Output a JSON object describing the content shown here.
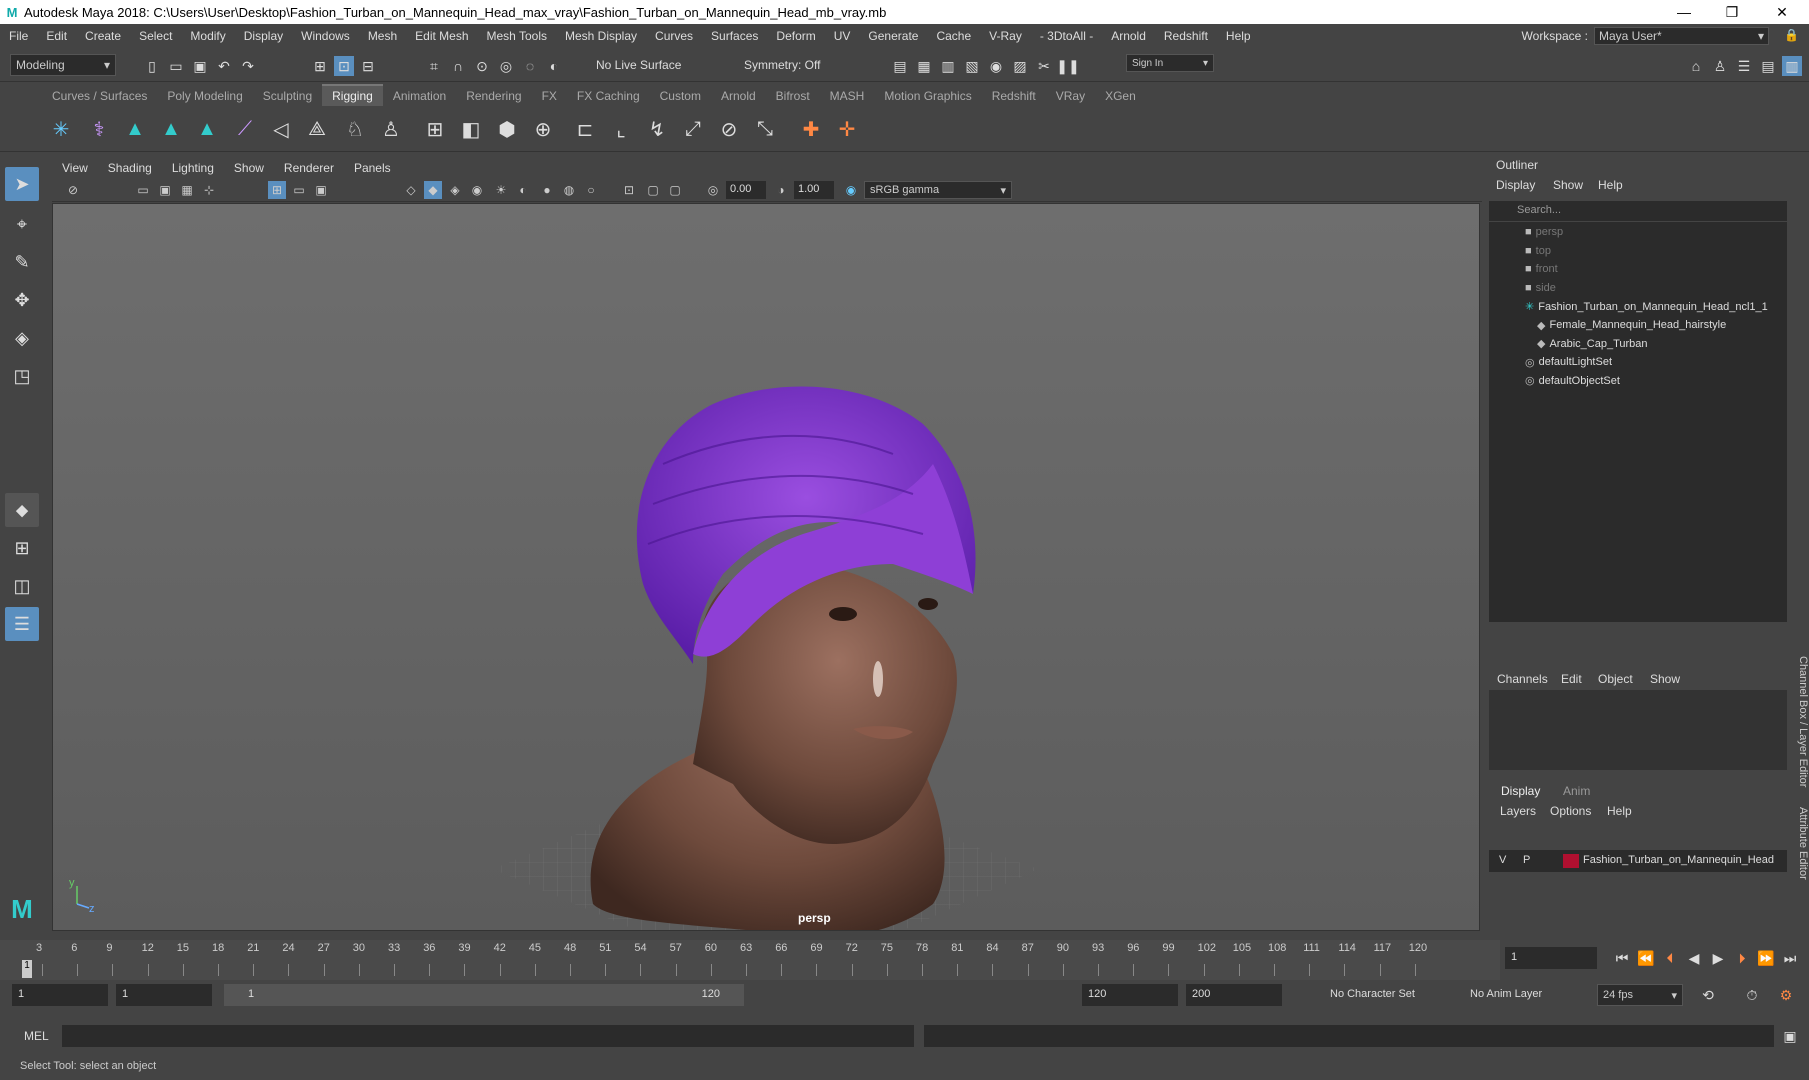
{
  "window": {
    "title": "Autodesk Maya 2018: C:\\Users\\User\\Desktop\\Fashion_Turban_on_Mannequin_Head_max_vray\\Fashion_Turban_on_Mannequin_Head_mb_vray.mb",
    "logo": "M",
    "min": "—",
    "max": "❐",
    "close": "✕"
  },
  "menubar": [
    "File",
    "Edit",
    "Create",
    "Select",
    "Modify",
    "Display",
    "Windows",
    "Mesh",
    "Edit Mesh",
    "Mesh Tools",
    "Mesh Display",
    "Curves",
    "Surfaces",
    "Deform",
    "UV",
    "Generate",
    "Cache",
    "V-Ray",
    "- 3DtoAll -",
    "Arnold",
    "Redshift",
    "Help"
  ],
  "workspace": {
    "label": "Workspace :",
    "value": "Maya User*"
  },
  "status": {
    "mode": "Modeling",
    "live_surface": "No Live Surface",
    "symmetry": "Symmetry: Off",
    "signin": "Sign In"
  },
  "shelf_tabs": [
    "Curves / Surfaces",
    "Poly Modeling",
    "Sculpting",
    "Rigging",
    "Animation",
    "Rendering",
    "FX",
    "FX Caching",
    "Custom",
    "Arnold",
    "Bifrost",
    "MASH",
    "Motion Graphics",
    "Redshift",
    "VRay",
    "XGen"
  ],
  "active_shelf": "Rigging",
  "viewport_menu": [
    "View",
    "Shading",
    "Lighting",
    "Show",
    "Renderer",
    "Panels"
  ],
  "viewport": {
    "exposure": "0.00",
    "gamma": "1.00",
    "colorspace": "sRGB gamma",
    "camera": "persp"
  },
  "outliner": {
    "title": "Outliner",
    "menu": [
      "Display",
      "Show",
      "Help"
    ],
    "search": "Search...",
    "items": [
      {
        "label": "persp",
        "dim": true,
        "icon": "camera-icon",
        "indent": 0
      },
      {
        "label": "top",
        "dim": true,
        "icon": "camera-icon",
        "indent": 0
      },
      {
        "label": "front",
        "dim": true,
        "icon": "camera-icon",
        "indent": 0
      },
      {
        "label": "side",
        "dim": true,
        "icon": "camera-icon",
        "indent": 0
      },
      {
        "label": "Fashion_Turban_on_Mannequin_Head_ncl1_1",
        "dim": false,
        "icon": "group-icon",
        "indent": 0
      },
      {
        "label": "Female_Mannequin_Head_hairstyle",
        "dim": false,
        "icon": "mesh-icon",
        "indent": 1
      },
      {
        "label": "Arabic_Cap_Turban",
        "dim": false,
        "icon": "mesh-icon",
        "indent": 1
      },
      {
        "label": "defaultLightSet",
        "dim": false,
        "icon": "set-icon",
        "indent": 0
      },
      {
        "label": "defaultObjectSet",
        "dim": false,
        "icon": "set-icon",
        "indent": 0
      }
    ]
  },
  "channelbox": {
    "menu": [
      "Channels",
      "Edit",
      "Object",
      "Show"
    ],
    "side_tab": "Channel Box / Layer Editor",
    "side_tab2": "Attribute Editor"
  },
  "layer_editor": {
    "tabs": [
      "Display",
      "Anim"
    ],
    "menu": [
      "Layers",
      "Options",
      "Help"
    ],
    "layer": {
      "v": "V",
      "p": "P",
      "name": "Fashion_Turban_on_Mannequin_Head",
      "color": "#b01030"
    }
  },
  "timeline": {
    "ticks": [
      "3",
      "6",
      "9",
      "12",
      "15",
      "18",
      "21",
      "24",
      "27",
      "30",
      "33",
      "36",
      "39",
      "42",
      "45",
      "48",
      "51",
      "54",
      "57",
      "60",
      "63",
      "66",
      "69",
      "72",
      "75",
      "78",
      "81",
      "84",
      "87",
      "90",
      "93",
      "96",
      "99",
      "102",
      "105",
      "108",
      "111",
      "114",
      "117",
      "120"
    ],
    "current": "1",
    "current_field": "1"
  },
  "range": {
    "start": "1",
    "start2": "1",
    "slider_start": "1",
    "slider_end": "120",
    "end": "120",
    "end2": "200",
    "charset": "No Character Set",
    "animlayer": "No Anim Layer",
    "fps": "24 fps"
  },
  "cmd": {
    "label": "MEL"
  },
  "help": "Select Tool: select an object",
  "axis": {
    "y": "y",
    "z": "z"
  }
}
